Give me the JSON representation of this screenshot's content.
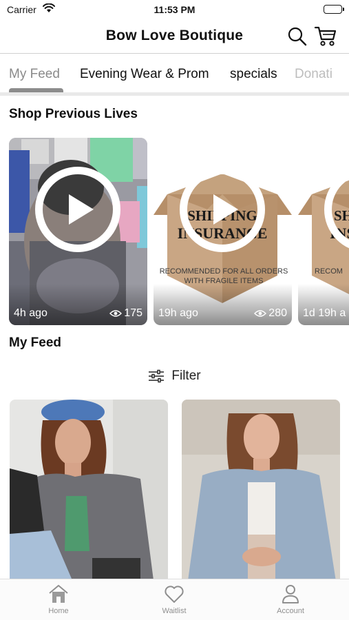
{
  "status_bar": {
    "carrier": "Carrier",
    "time": "11:53 PM"
  },
  "header": {
    "title": "Bow Love Boutique",
    "search_icon": "search-icon",
    "cart_icon": "cart-icon"
  },
  "tabs": [
    {
      "label": "My Feed",
      "active": true
    },
    {
      "label": "Evening Wear & Prom"
    },
    {
      "label": "specials"
    },
    {
      "label": "Donati"
    }
  ],
  "previous_lives": {
    "title": "Shop Previous Lives",
    "cards": [
      {
        "ago": "4h ago",
        "views": "175"
      },
      {
        "ago": "19h ago",
        "views": "280",
        "image_text": [
          "SHIPPING",
          "INSURANCE",
          "RECOMMENDED FOR ALL ORDERS",
          "WITH FRAGILE ITEMS"
        ]
      },
      {
        "ago": "1d 19h a",
        "views": "",
        "image_text": [
          "SH",
          "INS",
          "RECOM"
        ]
      }
    ]
  },
  "feed": {
    "title": "My Feed",
    "filter_label": "Filter"
  },
  "bottom_nav": [
    {
      "label": "Home",
      "icon": "home-icon"
    },
    {
      "label": "Waitlist",
      "icon": "heart-icon"
    },
    {
      "label": "Account",
      "icon": "person-icon"
    }
  ]
}
